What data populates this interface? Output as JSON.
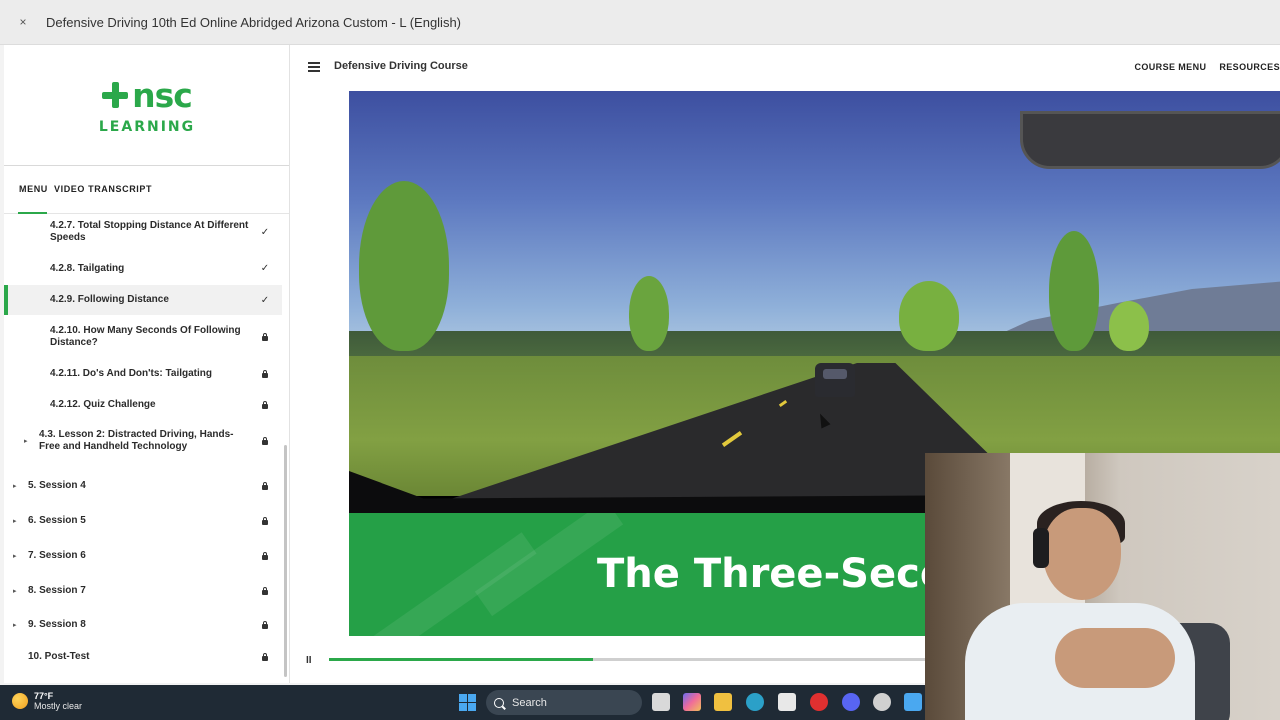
{
  "window": {
    "close_symbol": "×",
    "title": "Defensive Driving 10th Ed Online Abridged Arizona Custom - L (English)"
  },
  "logo": {
    "brand": "nsc",
    "sub": "LEARNING"
  },
  "sidebar": {
    "tabs": {
      "menu": "MENU",
      "transcript": "VIDEO TRANSCRIPT"
    },
    "items": [
      {
        "label": "4.2.7. Total Stopping Distance At Different Speeds",
        "state": "completed"
      },
      {
        "label": "4.2.8. Tailgating",
        "state": "completed"
      },
      {
        "label": "4.2.9. Following Distance",
        "state": "completed",
        "active": true
      },
      {
        "label": "4.2.10. How Many Seconds Of Following Distance?",
        "state": "locked"
      },
      {
        "label": "4.2.11. Do's And Don'ts: Tailgating",
        "state": "locked"
      },
      {
        "label": "4.2.12. Quiz Challenge",
        "state": "locked"
      },
      {
        "label": "4.3. Lesson 2: Distracted Driving, Hands-Free and Handheld Technology",
        "state": "locked"
      },
      {
        "label": "5. Session 4",
        "state": "locked"
      },
      {
        "label": "6. Session 5",
        "state": "locked"
      },
      {
        "label": "7. Session 6",
        "state": "locked"
      },
      {
        "label": "8. Session 7",
        "state": "locked"
      },
      {
        "label": "9. Session 8",
        "state": "locked"
      },
      {
        "label": "10. Post-Test",
        "state": "locked"
      }
    ],
    "check_symbol": "✓",
    "caret_symbol": "▸"
  },
  "header": {
    "course_title": "Defensive Driving Course",
    "course_menu": "COURSE MENU",
    "resources": "RESOURCES"
  },
  "video": {
    "banner_text": "The Three-Secon",
    "progress_fraction": 0.44,
    "pause_symbol": "II"
  },
  "taskbar": {
    "temperature": "77°F",
    "condition": "Mostly clear",
    "search_label": "Search"
  },
  "colors": {
    "brand_green": "#2ba84a",
    "banner_green": "#25a047",
    "taskbar_bg": "#1f2a35"
  }
}
